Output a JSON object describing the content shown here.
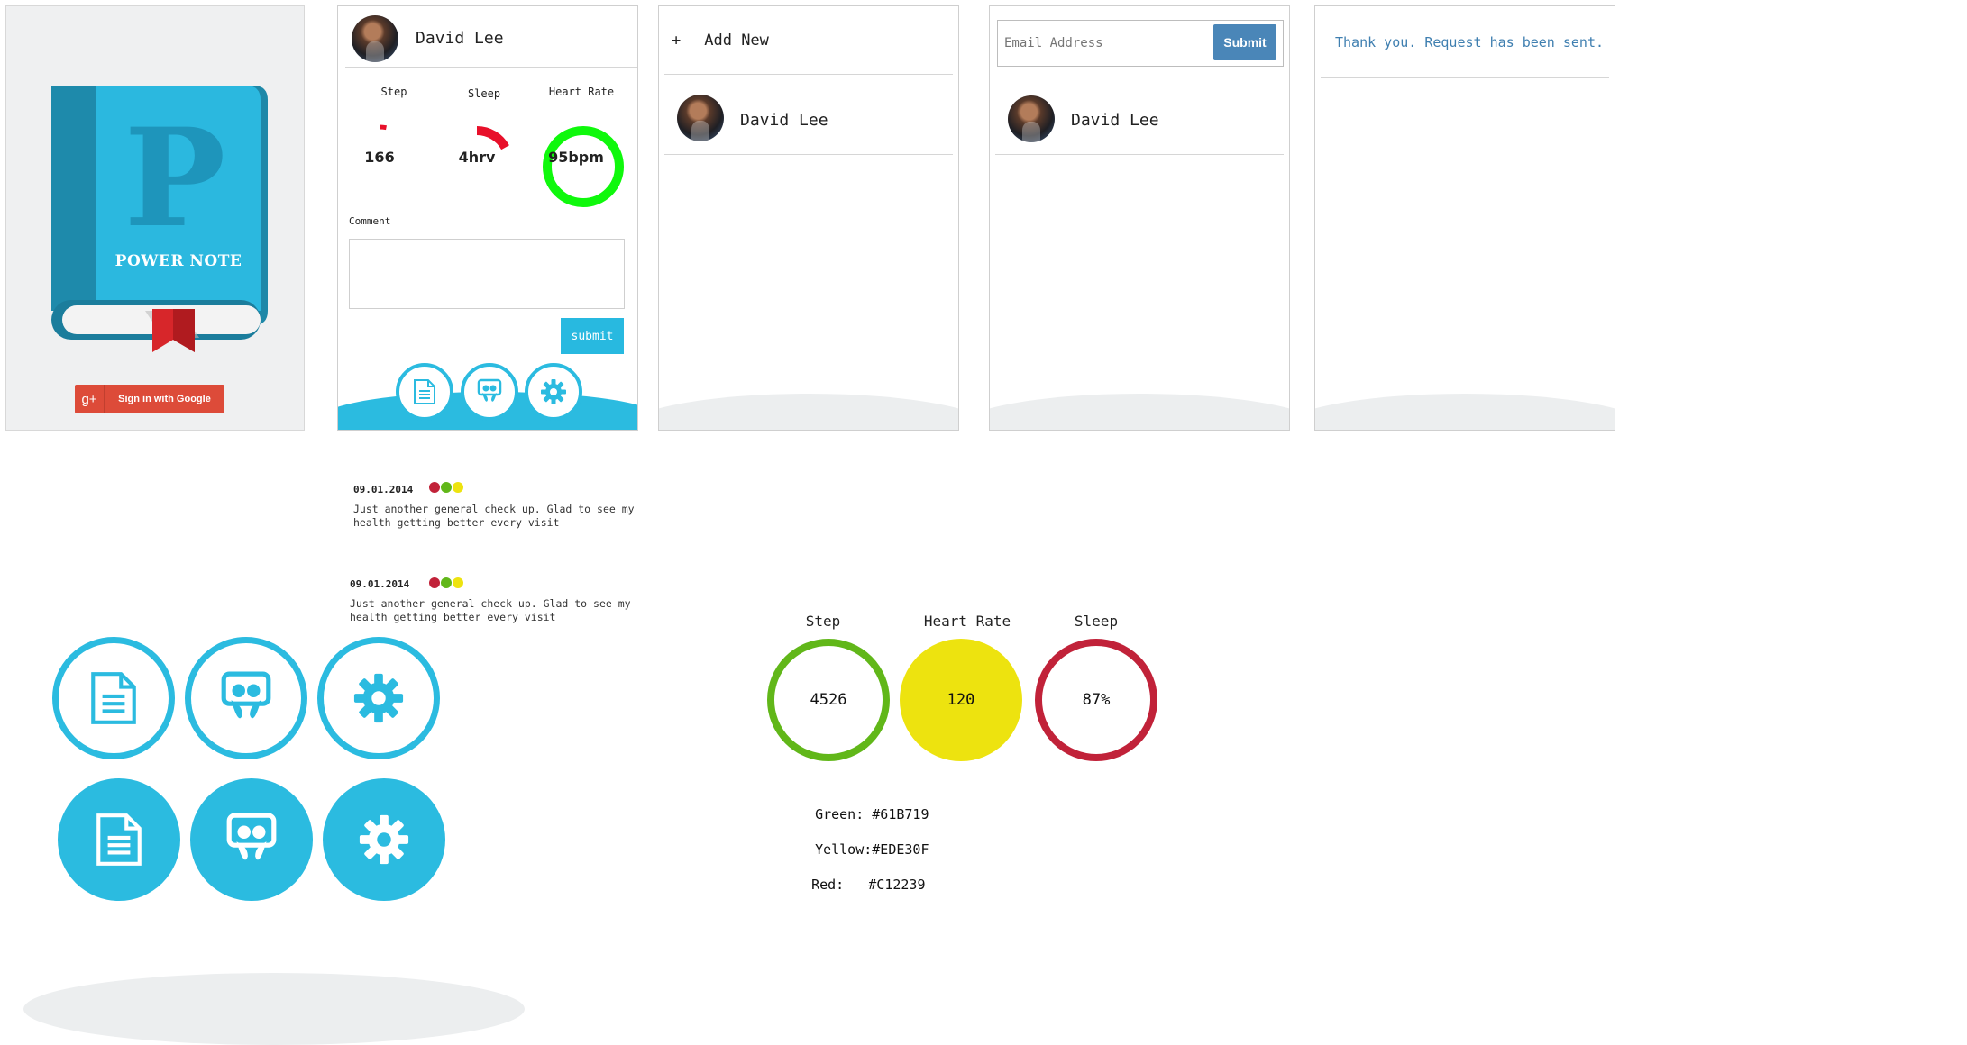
{
  "login": {
    "logo_text": "POWER NOTE",
    "logo_letter": "P",
    "google_button": "Sign in with Google",
    "google_icon": "g+"
  },
  "dashboard": {
    "user_name": "David Lee",
    "metrics": [
      {
        "label": "Step",
        "value": "166",
        "progress": 0.03,
        "color": "#E8102A"
      },
      {
        "label": "Sleep",
        "value": "4hrv",
        "progress": 0.17,
        "color": "#E8102A"
      },
      {
        "label": "Heart Rate",
        "value": "95bpm",
        "progress": 1.0,
        "color": "#0FF80C"
      }
    ],
    "comment_label": "Comment",
    "comment_value": "",
    "submit_label": "submit",
    "nav_icons": [
      "document-icon",
      "slideshare-icon",
      "gear-icon"
    ]
  },
  "patients": {
    "add_label": "Add New",
    "add_icon": "+",
    "items": [
      {
        "name": "David Lee"
      }
    ]
  },
  "invite": {
    "email_placeholder": "Email Address",
    "submit_label": "Submit",
    "items": [
      {
        "name": "David Lee"
      }
    ]
  },
  "confirmation": {
    "message": "Thank you. Request has been sent."
  },
  "notes": [
    {
      "date": "09.01.2014",
      "text": "Just another general check up. Glad to see my health getting better every visit",
      "dots": [
        "#C12239",
        "#61B719",
        "#EDE30F"
      ]
    },
    {
      "date": "09.01.2014",
      "text": "Just another general check up. Glad to see my health getting better every visit",
      "dots": [
        "#C12239",
        "#61B719",
        "#EDE30F"
      ]
    }
  ],
  "icon_sets": {
    "outline": [
      "document-icon",
      "slideshare-icon",
      "gear-icon"
    ],
    "filled": [
      "document-icon",
      "slideshare-icon",
      "gear-icon"
    ]
  },
  "rings": [
    {
      "label": "Step",
      "value": "4526",
      "style": "outline",
      "color": "#61B719"
    },
    {
      "label": "Heart Rate",
      "value": "120",
      "style": "filled",
      "color": "#EDE30F"
    },
    {
      "label": "Sleep",
      "value": "87%",
      "style": "outline",
      "color": "#C12239"
    }
  ],
  "palette": [
    {
      "name": "Green:",
      "hex": "#61B719"
    },
    {
      "name": "Yellow:",
      "hex": "#EDE30F"
    },
    {
      "name": "Red:",
      "hex": "#C12239"
    }
  ]
}
